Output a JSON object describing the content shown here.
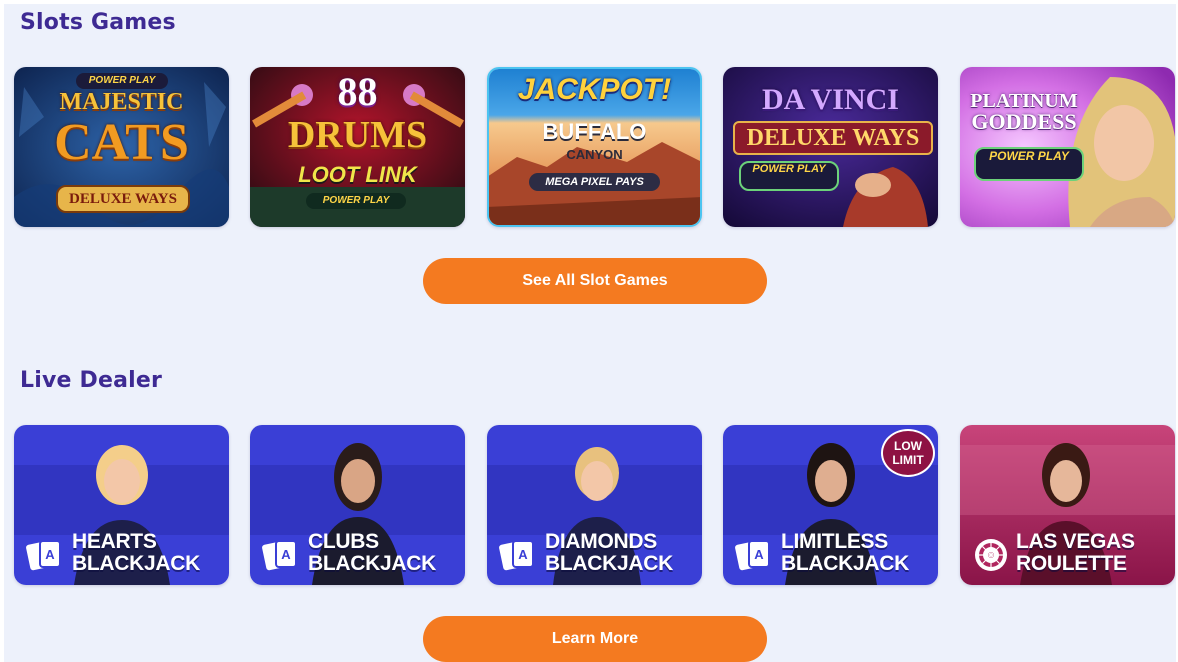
{
  "slots": {
    "title": "Slots Games",
    "games": [
      {
        "title": "Majestic Cats Deluxe Ways",
        "badge": "POWER PLAY",
        "line1": "MAJESTIC",
        "line2": "CATS",
        "line3": "DELUXE WAYS"
      },
      {
        "title": "88 Drums Loot Link",
        "line1": "88",
        "line2": "DRUMS",
        "line3": "LOOT LINK",
        "badge": "POWER PLAY"
      },
      {
        "title": "Jackpot! Buffalo Canyon Mega Pixel Pays",
        "line1": "JACKPOT!",
        "line2": "BUFFALO",
        "line3": "CANYON",
        "line4": "MEGA PIXEL PAYS"
      },
      {
        "title": "Da Vinci Deluxe Ways",
        "line1": "DA VINCI",
        "line2": "DELUXE WAYS",
        "badge": "POWER PLAY"
      },
      {
        "title": "Platinum Goddess",
        "line1": "PLATINUM",
        "line2": "GODDESS",
        "badge": "POWER PLAY"
      }
    ],
    "cta_label": "See All Slot Games"
  },
  "live_dealer": {
    "title": "Live Dealer",
    "games": [
      {
        "line1": "HEARTS",
        "line2": "BLACKJACK"
      },
      {
        "line1": "CLUBS",
        "line2": "BLACKJACK"
      },
      {
        "line1": "DIAMONDS",
        "line2": "BLACKJACK"
      },
      {
        "line1": "LIMITLESS",
        "line2": "BLACKJACK",
        "badge": "LOW LIMIT"
      },
      {
        "line1": "LAS VEGAS",
        "line2": "ROULETTE"
      }
    ],
    "cta_label": "Learn More"
  },
  "colors": {
    "page_bg": "#edf1fb",
    "heading": "#3e2a93",
    "cta": "#f47a20",
    "live_blue": "#3a3fd6",
    "roulette_magenta": "#b0265e"
  }
}
